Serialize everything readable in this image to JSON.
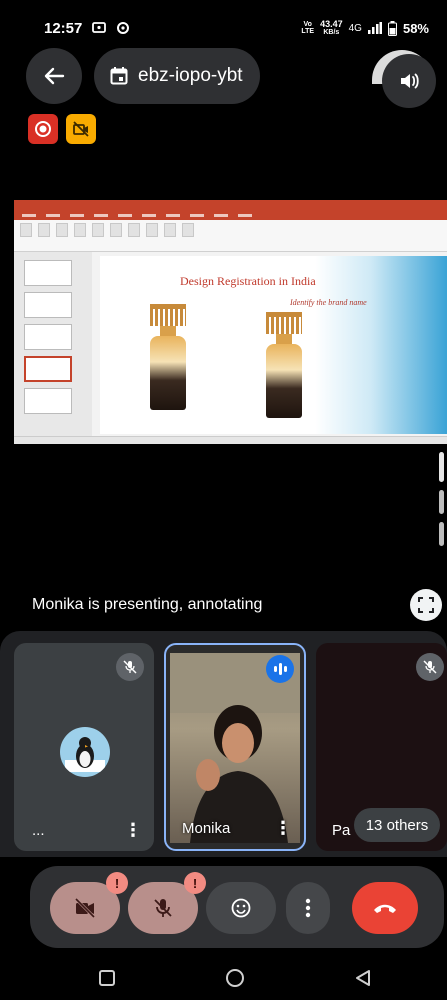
{
  "status_bar": {
    "time": "12:57",
    "network_volte": "Vo",
    "network_lte": "LTE",
    "speed_value": "43.47",
    "speed_unit": "KB/s",
    "network_type": "4G",
    "battery": "58%"
  },
  "header": {
    "meeting_code": "ebz-iopo-ybt"
  },
  "presentation": {
    "slide_title": "Design Registration in India",
    "slide_subtitle": "Identify the brand name"
  },
  "presenter_status": "Monika is presenting, annotating",
  "tiles": [
    {
      "name": "...",
      "muted": true
    },
    {
      "name": "Monika",
      "speaking": true
    },
    {
      "name": "Pa",
      "muted": true
    }
  ],
  "others_label": "13 others",
  "colors": {
    "background": "#000000",
    "tile_bg": "#3c4043",
    "accent_blue": "#1a73e8",
    "end_call_red": "#ea4335",
    "recording_red": "#d93025",
    "warning_yellow": "#f9ab00"
  },
  "icons": {
    "back": "arrow-left-icon",
    "calendar": "calendar-icon",
    "speaker": "speaker-icon",
    "recording": "recording-icon",
    "camera_off": "camera-off-icon",
    "fullscreen": "fullscreen-icon",
    "mic_off": "mic-off-icon",
    "emoji": "emoji-icon",
    "more": "more-vertical-icon",
    "end_call": "end-call-icon"
  }
}
